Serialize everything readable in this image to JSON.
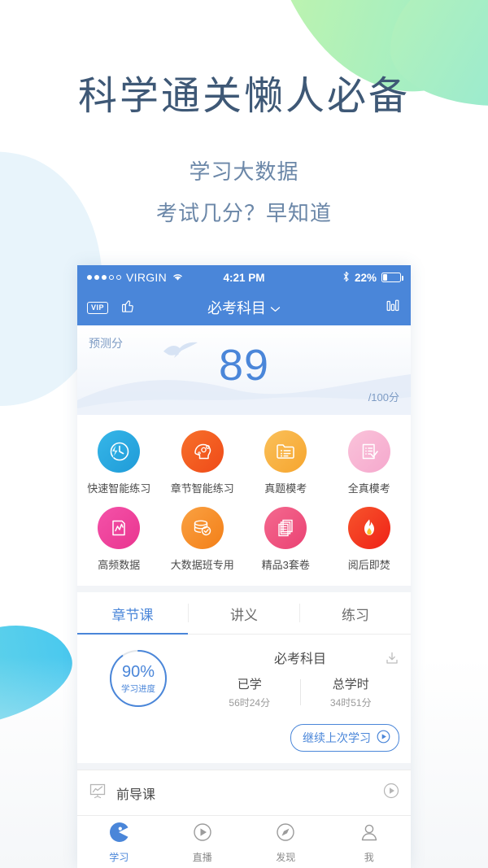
{
  "hero": {
    "title": "科学通关懒人必备",
    "subtitle1": "学习大数据",
    "subtitle2": "考试几分？早知道"
  },
  "colors": {
    "brand_blue": "#4a86d9",
    "hero_text": "#3e5876",
    "hero_sub": "#6b87a8",
    "blob_green": "#a8efc0",
    "blob_cyan": "#49c8ef",
    "blob_paleblue": "#e8f4fb"
  },
  "phone": {
    "statusbar": {
      "signal_dots_filled": 3,
      "signal_dots_total": 5,
      "carrier": "VIRGIN",
      "wifi_icon": "wifi-icon",
      "time": "4:21 PM",
      "bluetooth_icon": "bluetooth-icon",
      "battery_percent": "22%",
      "battery_level": 22
    },
    "navbar": {
      "vip_label": "VIP",
      "thumbs_up_icon": "thumbs-up-icon",
      "title": "必考科目",
      "chevron_icon": "chevron-down-icon",
      "chart_icon": "bar-chart-icon"
    },
    "score_card": {
      "label": "预测分",
      "value": "89",
      "unit": "/100分"
    },
    "grid": [
      {
        "label": "快速智能练习",
        "icon": "fast-smart-practice-icon",
        "color": "#29a8e0",
        "color2": "#1f9bd8"
      },
      {
        "label": "章节智能练习",
        "icon": "chapter-smart-practice-icon",
        "color": "#f4601f",
        "color2": "#ef4e1b"
      },
      {
        "label": "真题模考",
        "icon": "real-exam-icon",
        "color": "#f8b643",
        "color2": "#f6a832"
      },
      {
        "label": "全真模考",
        "icon": "full-mock-exam-icon",
        "color": "#f7b9d3",
        "color2": "#f5add0"
      },
      {
        "label": "高频数据",
        "icon": "high-frequency-data-icon",
        "color": "#ef3f9e",
        "color2": "#e93b9b"
      },
      {
        "label": "大数据班专用",
        "icon": "bigdata-class-icon",
        "color": "#f79433",
        "color2": "#f4861f"
      },
      {
        "label": "精品3套卷",
        "icon": "premium-papers-icon",
        "color": "#ef527f",
        "color2": "#eb4b7c"
      },
      {
        "label": "阅后即焚",
        "icon": "burn-after-reading-icon",
        "color": "#f4442a",
        "color2": "#ef2f1d"
      }
    ],
    "tabs": [
      {
        "label": "章节课",
        "active": true
      },
      {
        "label": "讲义",
        "active": false
      },
      {
        "label": "练习",
        "active": false
      }
    ],
    "progress": {
      "percent": "90%",
      "percent_value": 90,
      "caption": "学习进度",
      "course_title": "必考科目",
      "download_icon": "download-icon",
      "stats": [
        {
          "key": "已学",
          "value": "56时24分"
        },
        {
          "key": "总学时",
          "value": "34时51分"
        }
      ]
    },
    "continue": {
      "label": "继续上次学习",
      "icon": "play-circle-icon"
    },
    "lesson": {
      "icon": "chart-board-icon",
      "title": "前导课",
      "play_icon": "play-circle-icon"
    },
    "tabbar": [
      {
        "label": "学习",
        "icon": "pacman-study-icon",
        "active": true
      },
      {
        "label": "直播",
        "icon": "play-circle-icon",
        "active": false
      },
      {
        "label": "发现",
        "icon": "compass-icon",
        "active": false
      },
      {
        "label": "我",
        "icon": "person-icon",
        "active": false
      }
    ]
  }
}
